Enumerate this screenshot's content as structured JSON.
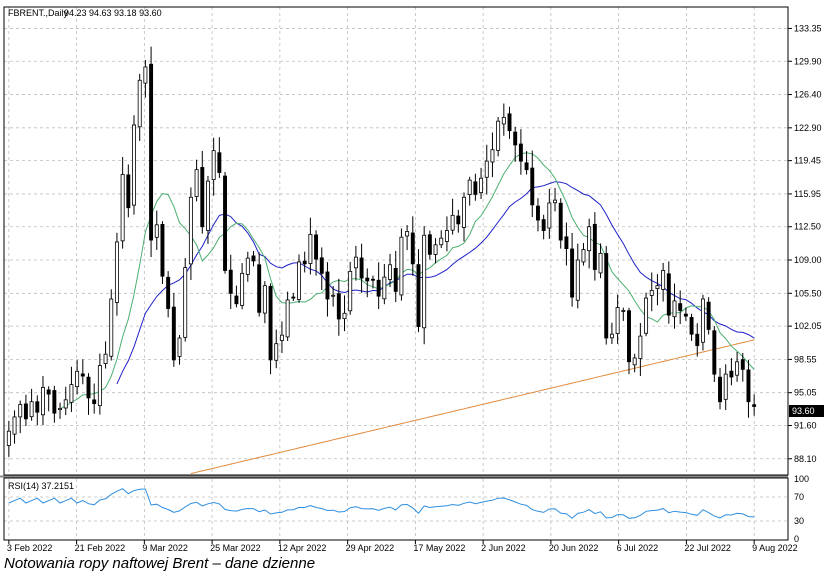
{
  "chart_data": [
    {
      "type": "candlestick",
      "title": "FBRENT.,Daily",
      "ohlc_header": "94.23 94.63 93.18 93.60",
      "last_price_label": "93.60",
      "ylim": [
        86.5,
        135.5
      ],
      "y_ticks": [
        "133.35",
        "129.90",
        "126.40",
        "122.90",
        "119.45",
        "115.95",
        "112.50",
        "109.00",
        "105.50",
        "102.05",
        "98.55",
        "95.05",
        "91.60",
        "88.10"
      ],
      "x_tick_labels": [
        "3 Feb 2022",
        "21 Feb 2022",
        "9 Mar 2022",
        "25 Mar 2022",
        "12 Apr 2022",
        "29 Apr 2022",
        "17 May 2022",
        "2 Jun 2022",
        "20 Jun 2022",
        "6 Jul 2022",
        "22 Jul 2022",
        "9 Aug 2022"
      ],
      "grid": true,
      "close": [
        91.0,
        92.5,
        93.8,
        92.3,
        94.1,
        93.0,
        95.6,
        94.9,
        92.9,
        93.4,
        94.3,
        95.9,
        97.3,
        96.8,
        94.5,
        93.9,
        97.9,
        99.1,
        104.9,
        110.9,
        118.0,
        114.5,
        123.2,
        127.9,
        129.3,
        111.1,
        112.7,
        107.3,
        103.9,
        98.5,
        100.8,
        108.2,
        115.6,
        118.5,
        112.5,
        117.3,
        120.5,
        118.2,
        107.9,
        105.5,
        104.4,
        107.6,
        109.2,
        108.9,
        103.5,
        106.3,
        98.5,
        100.2,
        101.1,
        104.8,
        105.1,
        108.8,
        108.6,
        111.7,
        109.1,
        107.6,
        104.9,
        105.3,
        102.8,
        103.4,
        107.8,
        109.3,
        107.1,
        106.8,
        106.9,
        105.2,
        107.2,
        108.5,
        105.7,
        111.4,
        112.0,
        108.6,
        102.0,
        111.6,
        109.6,
        110.6,
        111.3,
        112.1,
        113.7,
        112.8,
        115.6,
        117.4,
        115.9,
        117.6,
        119.4,
        120.6,
        123.6,
        124.0,
        122.6,
        121.1,
        119.4,
        118.5,
        114.8,
        113.2,
        112.1,
        115.0,
        115.3,
        111.1,
        110.2,
        105.1,
        109.0,
        110.1,
        112.5,
        108.0,
        109.7,
        100.8,
        101.2,
        104.0,
        103.7,
        98.3,
        98.7,
        101.0,
        105.0,
        105.8,
        106.3,
        107.9,
        103.2,
        104.7,
        103.7,
        103.1,
        101.2,
        100.0,
        104.9,
        101.7,
        97.0,
        94.1,
        97.0,
        96.7,
        98.3,
        97.5,
        94.1,
        93.6
      ]
    },
    {
      "type": "line",
      "title": "RSI(14) 37.2151",
      "ylim": [
        0,
        100
      ],
      "y_ticks": [
        "100",
        "70",
        "30",
        "0"
      ],
      "tick_values": [
        100,
        70,
        30,
        0
      ]
    }
  ],
  "indicators": {
    "ma_fast_color": "#4caf72",
    "ma_mid_color": "#1f1fc8",
    "ma_slow_color": "#e08a3c",
    "rsi_color": "#2f8fe0",
    "candle_color": "#000000"
  },
  "caption": "Notowania ropy naftowej Brent – dane dzienne"
}
